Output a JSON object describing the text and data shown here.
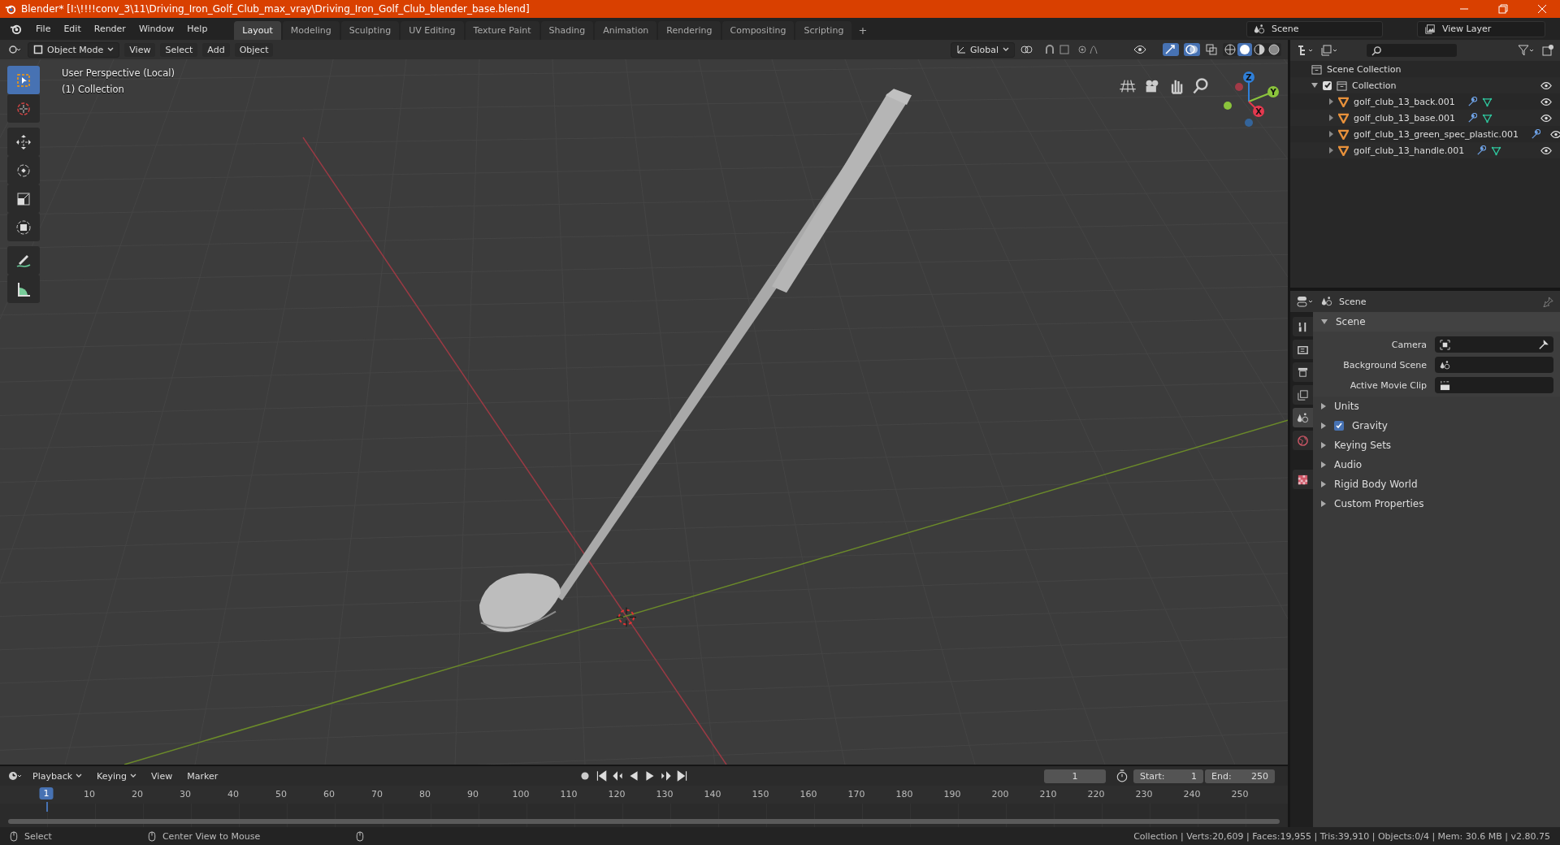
{
  "window": {
    "title": "Blender* [I:\\!!!!conv_3\\11\\Driving_Iron_Golf_Club_max_vray\\Driving_Iron_Golf_Club_blender_base.blend]"
  },
  "menu": [
    "File",
    "Edit",
    "Render",
    "Window",
    "Help"
  ],
  "workspaces": [
    {
      "label": "Layout",
      "selected": true
    },
    {
      "label": "Modeling",
      "selected": false
    },
    {
      "label": "Sculpting",
      "selected": false
    },
    {
      "label": "UV Editing",
      "selected": false
    },
    {
      "label": "Texture Paint",
      "selected": false
    },
    {
      "label": "Shading",
      "selected": false
    },
    {
      "label": "Animation",
      "selected": false
    },
    {
      "label": "Rendering",
      "selected": false
    },
    {
      "label": "Compositing",
      "selected": false
    },
    {
      "label": "Scripting",
      "selected": false
    }
  ],
  "add_workspace": "+",
  "scene": "Scene",
  "view_layer": "View Layer",
  "viewport_header": {
    "mode": "Object Mode",
    "menus": [
      "View",
      "Select",
      "Add",
      "Object"
    ],
    "orientation": "Global"
  },
  "viewport": {
    "overlay_text": [
      "User Perspective (Local)",
      "(1) Collection"
    ],
    "tools": [
      {
        "kind": "select",
        "selected": true
      },
      {
        "kind": "cursor",
        "selected": false
      },
      {
        "kind": "move",
        "selected": false
      },
      {
        "kind": "rotate",
        "selected": false
      },
      {
        "kind": "scale",
        "selected": false
      },
      {
        "kind": "transform",
        "selected": false
      },
      {
        "kind": "annotate",
        "selected": false
      },
      {
        "kind": "measure",
        "selected": false
      }
    ],
    "gizmo": [
      {
        "label": "Z",
        "color": "#2f7fd8"
      },
      {
        "label": "Y",
        "color": "#8bc43c"
      },
      {
        "label": "X",
        "color": "#e5394f"
      }
    ]
  },
  "outliner": {
    "root": "Scene Collection",
    "collection": {
      "label": "Collection",
      "checked": true,
      "expanded": true,
      "children": [
        {
          "label": "golf_club_13_back.001",
          "mesh_data": true
        },
        {
          "label": "golf_club_13_base.001",
          "mesh_data": true
        },
        {
          "label": "golf_club_13_green_spec_plastic.001",
          "mesh_data": false
        },
        {
          "label": "golf_club_13_handle.001",
          "mesh_data": true
        }
      ]
    }
  },
  "properties": {
    "context": "Scene",
    "tabs": [
      {
        "kind": "tool",
        "selected": false
      },
      {
        "kind": "render",
        "selected": false
      },
      {
        "kind": "output",
        "selected": false
      },
      {
        "kind": "view_layer",
        "selected": false
      },
      {
        "kind": "scene",
        "selected": true
      },
      {
        "kind": "world",
        "selected": false
      },
      {
        "kind": "texture",
        "selected": false
      }
    ],
    "panel": {
      "title": "Scene",
      "expanded": true,
      "fields": [
        {
          "label": "Camera",
          "kind": "camera"
        },
        {
          "label": "Background Scene",
          "kind": "scene"
        },
        {
          "label": "Active Movie Clip",
          "kind": "clip"
        }
      ]
    },
    "subpanels": [
      {
        "label": "Units",
        "kind": "plain"
      },
      {
        "label": "Gravity",
        "kind": "checkbox",
        "checked": true
      },
      {
        "label": "Keying Sets",
        "kind": "plain"
      },
      {
        "label": "Audio",
        "kind": "plain"
      },
      {
        "label": "Rigid Body World",
        "kind": "plain"
      },
      {
        "label": "Custom Properties",
        "kind": "plain"
      }
    ]
  },
  "timeline": {
    "menus": [
      "Playback",
      "Keying",
      "View",
      "Marker"
    ],
    "current_frame": "1",
    "start_label": "Start:",
    "start": "1",
    "end_label": "End:",
    "end": "250",
    "ruler": [
      "1",
      "10",
      "20",
      "30",
      "40",
      "50",
      "60",
      "70",
      "80",
      "90",
      "100",
      "110",
      "120",
      "130",
      "140",
      "150",
      "160",
      "170",
      "180",
      "190",
      "200",
      "210",
      "220",
      "230",
      "240",
      "250"
    ]
  },
  "status_bar": {
    "hints": [
      "Select",
      "Center View to Mouse"
    ],
    "stats": "Collection | Verts:20,609 | Faces:19,955 | Tris:39,910 | Objects:0/4 | Mem: 30.6 MB | v2.80.75"
  }
}
